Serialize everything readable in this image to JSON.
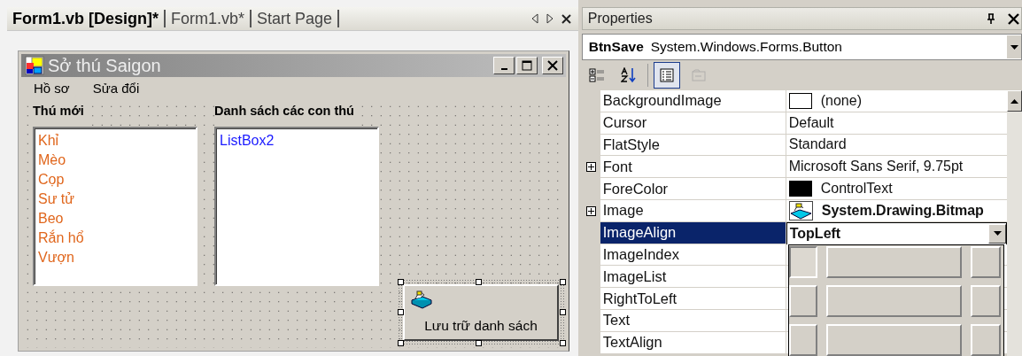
{
  "document_tabs": [
    {
      "label": "Form1.vb [Design]*",
      "selected": true
    },
    {
      "label": "Form1.vb*",
      "selected": false
    },
    {
      "label": "Start Page",
      "selected": false
    }
  ],
  "form": {
    "title": "Sở thú Saigon",
    "menu": [
      "Hồ sơ",
      "Sửa đổi"
    ],
    "labels": [
      "Thú mới",
      "Danh sách các con thú"
    ],
    "listbox_1": {
      "items": [
        "Khỉ",
        "Mèo",
        "Cọp",
        "Sư tử",
        "Beo",
        "Rắn hổ",
        "Vượn"
      ]
    },
    "listbox_2": {
      "items": [
        "ListBox2"
      ]
    },
    "button": {
      "label": "Lưu trữ danh sách",
      "selected": true
    }
  },
  "properties": {
    "title": "Properties",
    "object": {
      "name": "BtnSave",
      "type": "System.Windows.Forms.Button"
    },
    "toolbar": [
      {
        "kind": "categorized",
        "selected": false
      },
      {
        "kind": "alphabetic",
        "selected": false
      },
      {
        "kind": "properties",
        "selected": true
      },
      {
        "kind": "pages",
        "selected": false,
        "disabled": true
      }
    ],
    "rows": [
      {
        "name": "BackgroundImage",
        "value": "(none)",
        "kind": "swatch",
        "color": "#ffffff",
        "expandable": false,
        "bold": false,
        "selected": false
      },
      {
        "name": "Cursor",
        "value": "Default",
        "kind": "text",
        "expandable": false,
        "bold": false,
        "selected": false
      },
      {
        "name": "FlatStyle",
        "value": "Standard",
        "kind": "text",
        "expandable": false,
        "bold": false,
        "selected": false
      },
      {
        "name": "Font",
        "value": "Microsoft Sans Serif, 9.75pt",
        "kind": "text",
        "expandable": true,
        "bold": false,
        "selected": false
      },
      {
        "name": "ForeColor",
        "value": "ControlText",
        "kind": "swatch",
        "color": "#000000",
        "expandable": false,
        "bold": false,
        "selected": false
      },
      {
        "name": "Image",
        "value": "System.Drawing.Bitmap",
        "kind": "bitmap",
        "expandable": true,
        "bold": true,
        "selected": false
      },
      {
        "name": "ImageAlign",
        "value": "TopLeft",
        "kind": "dropdown",
        "expandable": false,
        "bold": true,
        "selected": true
      },
      {
        "name": "ImageIndex",
        "kind": "text",
        "expandable": false,
        "selected": false
      },
      {
        "name": "ImageList",
        "kind": "text",
        "expandable": false,
        "selected": false
      },
      {
        "name": "RightToLeft",
        "kind": "text",
        "expandable": false,
        "selected": false
      },
      {
        "name": "Text",
        "kind": "text",
        "expandable": false,
        "selected": false
      },
      {
        "name": "TextAlign",
        "kind": "text",
        "expandable": false,
        "selected": false
      }
    ],
    "align_picker": [
      {
        "selected": true
      },
      {
        "selected": false
      },
      {
        "selected": false
      },
      {
        "selected": false
      },
      {
        "selected": false
      },
      {
        "selected": false
      },
      {
        "selected": false
      },
      {
        "selected": false
      },
      {
        "selected": false
      }
    ]
  }
}
